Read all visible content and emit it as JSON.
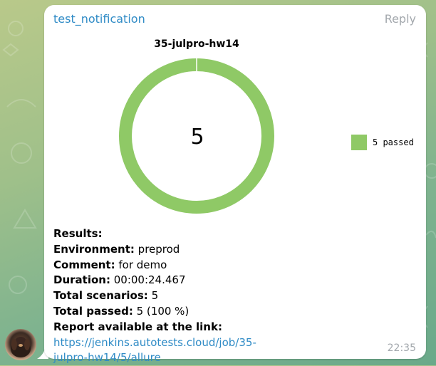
{
  "message": {
    "sender": "test_notification",
    "reply_label": "Reply",
    "time": "22:35"
  },
  "chart_data": {
    "type": "pie",
    "title": "35-julpro-hw14",
    "center_label": "5",
    "categories": [
      "5 passed"
    ],
    "values": [
      5
    ],
    "colors": [
      "#8fc966"
    ],
    "legend_position": "right"
  },
  "results": {
    "heading": "Results:",
    "lines": [
      {
        "label": "Environment:",
        "value": "preprod"
      },
      {
        "label": "Comment:",
        "value": "for demo"
      },
      {
        "label": "Duration:",
        "value": "00:00:24.467"
      },
      {
        "label": "Total scenarios:",
        "value": "5"
      },
      {
        "label": "Total passed:",
        "value": "5 (100 %)"
      }
    ],
    "report_label": "Report available at the link:",
    "report_link_part1": "https://jenkins.autotests.cloud/job/35-",
    "report_link_part2": "julpro-hw14/5/allure"
  }
}
